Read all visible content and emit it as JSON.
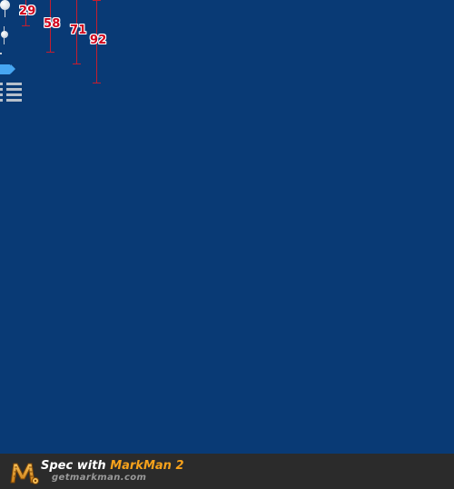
{
  "measurements": [
    {
      "label": "29"
    },
    {
      "label": "58"
    },
    {
      "label": "71"
    },
    {
      "label": "92"
    }
  ],
  "controls": {
    "pin_large_icon": "pin-icon",
    "pin_small_icon": "pin-icon",
    "tag_icon": "tag-icon",
    "list_icon": "list-icon"
  },
  "colors": {
    "background": "#093a75",
    "measure_line": "#c41e2f",
    "measure_text": "#d0021b",
    "tag_blue": "#47a6f2",
    "footer_bg": "#2b2b2b",
    "footer_accent": "#f7a21b"
  },
  "footer": {
    "title_prefix": "Spec with ",
    "title_product": "MarkMan 2",
    "url": "getmarkman.com",
    "logo_icon": "markman-logo-icon"
  }
}
